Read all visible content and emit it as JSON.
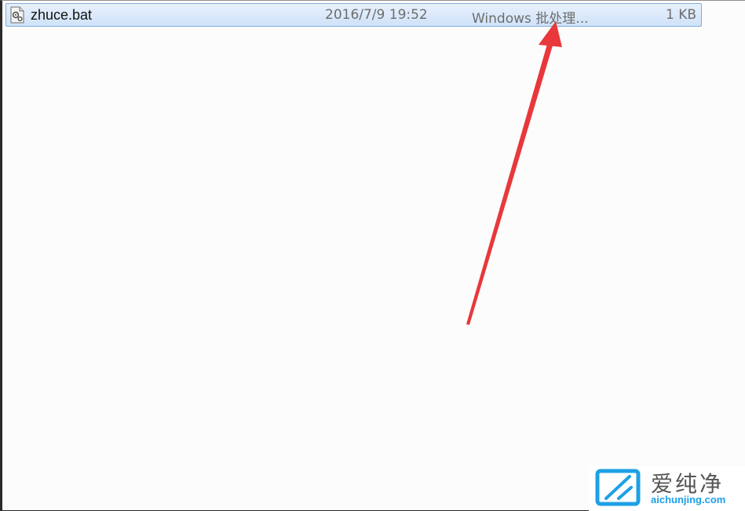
{
  "file_list": {
    "rows": [
      {
        "icon": "batch-file-icon",
        "name": "zhuce.bat",
        "modified": "2016/7/9 19:52",
        "type": "Windows 批处理...",
        "size": "1 KB",
        "selected": true
      }
    ]
  },
  "annotation": {
    "type": "red-arrow",
    "color": "#e8383b"
  },
  "watermark": {
    "logo_icon": "aichunjing-logo",
    "chinese_text": "爱纯净",
    "url": "aichunjing.com"
  },
  "colors": {
    "selection_fill": "#cfe2f8",
    "selection_border": "#84acdd",
    "arrow": "#e8383b",
    "watermark_blue": "#1ea0e6"
  }
}
